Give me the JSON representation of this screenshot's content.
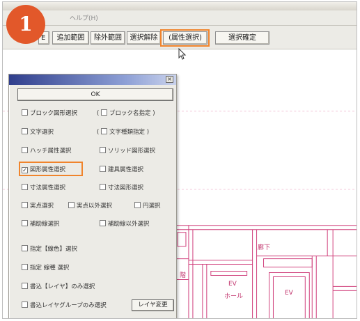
{
  "step_badge": "1",
  "menubar": {
    "text": "ヘルプ(H)"
  },
  "toolbar": {
    "partial_button": "E",
    "buttons": [
      "追加範囲",
      "除外範囲",
      "選択解除",
      "(属性選択)",
      "選択確定"
    ],
    "highlighted_index": 3
  },
  "dialog": {
    "close_label": "×",
    "ok_label": "OK",
    "options": [
      {
        "label": "ブロック図形選択",
        "checked": false
      },
      {
        "label": "ブロック名指定",
        "checked": false,
        "parenthesized": true
      },
      {
        "label": "文字選択",
        "checked": false
      },
      {
        "label": "文字種類指定",
        "checked": false,
        "parenthesized": true
      },
      {
        "label": "ハッチ属性選択",
        "checked": false
      },
      {
        "label": "ソリッド図形選択",
        "checked": false
      },
      {
        "label": "図形属性選択",
        "checked": true
      },
      {
        "label": "建具属性選択",
        "checked": false
      },
      {
        "label": "寸法属性選択",
        "checked": false
      },
      {
        "label": "寸法図形選択",
        "checked": false
      },
      {
        "label": "実点選択",
        "checked": false
      },
      {
        "label": "実点以外選択",
        "checked": false
      },
      {
        "label": "円選択",
        "checked": false
      },
      {
        "label": "補助線選択",
        "checked": false
      },
      {
        "label": "補助線以外選択",
        "checked": false
      },
      {
        "label": "指定【線色】選択",
        "checked": false
      },
      {
        "label": "指定 線種 選択",
        "checked": false
      },
      {
        "label": "書込【レイヤ】のみ選択",
        "checked": false
      },
      {
        "label": "書込レイヤグループのみ選択",
        "checked": false
      }
    ],
    "layer_change_button": "レイヤ変更"
  },
  "drawing": {
    "labels": [
      "廊下",
      "EV",
      "ホール",
      "EV",
      "階"
    ]
  },
  "colors": {
    "badge": "#e2582a",
    "highlight": "#f0842c",
    "cad_lines": "#d0407c",
    "dialog_titlebar": "#2f3e8c"
  }
}
